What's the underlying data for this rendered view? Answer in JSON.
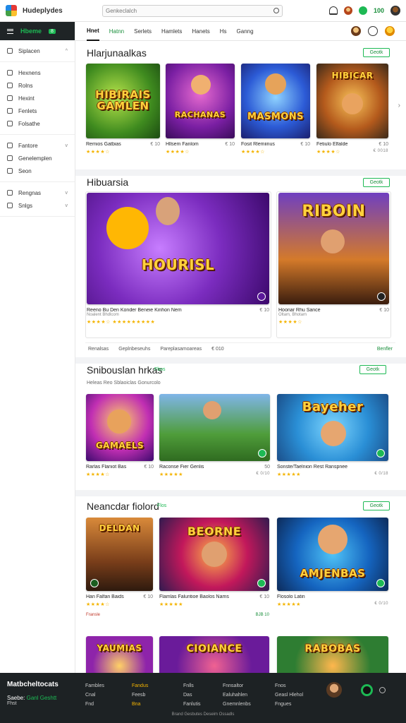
{
  "app": {
    "brand": "Hudeplydes"
  },
  "search": {
    "placeholder": "Genkeclalch"
  },
  "header": {
    "coins": "100"
  },
  "sidebar": {
    "home_label": "Hbeme",
    "home_badge": "8",
    "groups": [
      {
        "items": [
          {
            "label": "Siplacen",
            "icon": "controller-icon",
            "chevron": "^"
          }
        ]
      },
      {
        "items": [
          {
            "label": "Hexnens",
            "icon": "home-icon"
          },
          {
            "label": "Rolns",
            "icon": "list-icon"
          },
          {
            "label": "Hexint",
            "icon": "clock-icon"
          },
          {
            "label": "Fenlets",
            "icon": "settings-icon"
          },
          {
            "label": "Folsathe",
            "icon": "folder-icon"
          }
        ]
      },
      {
        "items": [
          {
            "label": "Fantore",
            "icon": "grid-icon",
            "chevron": "v"
          },
          {
            "label": "Genelemplen",
            "icon": "user-icon"
          },
          {
            "label": "Seon",
            "icon": "document-icon"
          }
        ]
      },
      {
        "items": [
          {
            "label": "Rengnas",
            "icon": "gift-icon",
            "chevron": "v"
          },
          {
            "label": "Snlgs",
            "icon": "help-icon",
            "chevron": "v"
          }
        ]
      }
    ]
  },
  "tabs": [
    {
      "label": "Hnet",
      "active": true
    },
    {
      "label": "Hatnn",
      "green": true
    },
    {
      "label": "Serlets"
    },
    {
      "label": "Hamlets"
    },
    {
      "label": "Hanets"
    },
    {
      "label": "Hs"
    },
    {
      "label": "Ganng"
    }
  ],
  "sections": {
    "s1": {
      "title": "Hlarjunaalkas",
      "see_all": "Geotk",
      "cards": [
        {
          "thumb_text": "HIBIRAIS GAMLEN",
          "title": "Remios Gatbias",
          "price": "€ 10"
        },
        {
          "thumb_text": "RACHANAS",
          "title": "Hllsem Fanlom",
          "price": "€ 10"
        },
        {
          "thumb_text": "MASMONS",
          "title": "Fosit Rlemiinus",
          "price": "€ 10"
        },
        {
          "thumb_text": "HIBICAR",
          "title": "Fetiulo Elfalde",
          "price": "€ 10",
          "meta": "€ 0018"
        }
      ]
    },
    "s2": {
      "title": "Hibuarsia",
      "see_all": "Geotk",
      "cards": [
        {
          "thumb_text": "HOURISL",
          "title": "Reeno Bu Den Konder Beneie Kinhon Nem",
          "price": "€ 10",
          "sub": "Noalent Bhdlcom"
        },
        {
          "thumb_text": "RIBOIN",
          "title": "Hoonar Rhu Sance",
          "price": "€ 10",
          "sub": "Oltam, Bhotam"
        }
      ],
      "filters": [
        "Renalsas",
        "Geplnbeseuhs",
        "Pareplasamoareas"
      ],
      "filter_count": "€ 010",
      "filter_right": "Benfler"
    },
    "s3": {
      "title": "Snibouslan hrkas",
      "pill": "Fbos",
      "see_all": "Geotk",
      "subtitle": "Heleas Reo Sblaoiclas",
      "subtitle_tail": "Gonurcolo",
      "cards": [
        {
          "thumb_text": "GAMAELS",
          "title": "Rarlas Flaniot Bas",
          "price": "€ 10"
        },
        {
          "thumb_text": "",
          "title": "Raconse Fier Genlis",
          "price": "50",
          "meta": "€ 0/10"
        },
        {
          "thumb_text": "Bayeher",
          "title": "Sonste/Taelnion Rest Ranspnee",
          "price": "",
          "meta": "€ 0/18"
        }
      ]
    },
    "s4": {
      "title": "Neancdar fiolord",
      "pill": "Flos",
      "see_all": "Geotk",
      "cards": [
        {
          "thumb_text": "DELDAN",
          "title": "Han Falfan Baids",
          "price": "€ 10",
          "meta": "Fransle"
        },
        {
          "thumb_text": "BEORNE",
          "title": "Flamlas Faluntioe Baolos Nams",
          "price": "€ 10",
          "meta": "BJB 10"
        },
        {
          "thumb_text": "AMJENBAS",
          "title": "Flosolo Latin",
          "price": "",
          "meta": "€ 0/10"
        }
      ]
    },
    "s5": {
      "cards": [
        {
          "thumb_text": "YAUMIAS"
        },
        {
          "thumb_text": "CIOIANCE"
        },
        {
          "thumb_text": "RABOBAS"
        }
      ]
    }
  },
  "footer": {
    "brand": "Matbcheltocats",
    "sub_prefix": "Saebe:",
    "sub_green": "Ganl Geshtt",
    "sub2": "Fhst",
    "col1": [
      "Fambles",
      "Cnal",
      "Fnd"
    ],
    "col2": [
      "Fandus",
      "Feesb",
      "Bna"
    ],
    "col3": [
      "Fnlls",
      "Das",
      "Fanlutis"
    ],
    "col4": [
      "Fnnsaltor",
      "Ealuhahlen",
      "Gnemnlenbs"
    ],
    "col5": [
      "Fnos",
      "Geasl Hlehol",
      "Fngues"
    ],
    "bottom": "Brand Gesbutes Deseim Ossadls"
  }
}
